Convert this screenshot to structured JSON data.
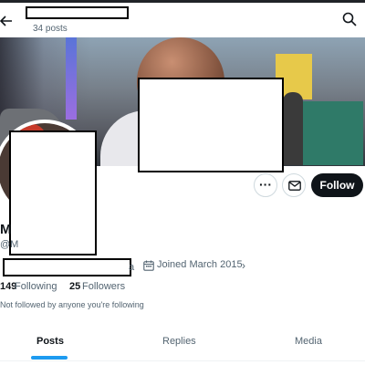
{
  "header": {
    "back_icon": "arrow-left-icon",
    "posts_count": "34 posts",
    "search_icon": "search-icon"
  },
  "profile": {
    "name_visible": "M",
    "handle_visible": "@M",
    "location_tail": "a",
    "joined": "Joined March 2015",
    "joined_chevron": "›",
    "following_count": "149",
    "following_label": "Following",
    "followers_count": "25",
    "followers_label": "Followers",
    "not_followed": "Not followed by anyone you're following"
  },
  "actions": {
    "more_label": "···",
    "mail_icon": "envelope-icon",
    "follow_label": "Follow"
  },
  "tabs": [
    {
      "label": "Posts"
    },
    {
      "label": "Replies"
    },
    {
      "label": "Media"
    }
  ],
  "colors": {
    "accent": "#1d9bf0",
    "follow_bg": "#0f1419",
    "muted_text": "#536471"
  }
}
